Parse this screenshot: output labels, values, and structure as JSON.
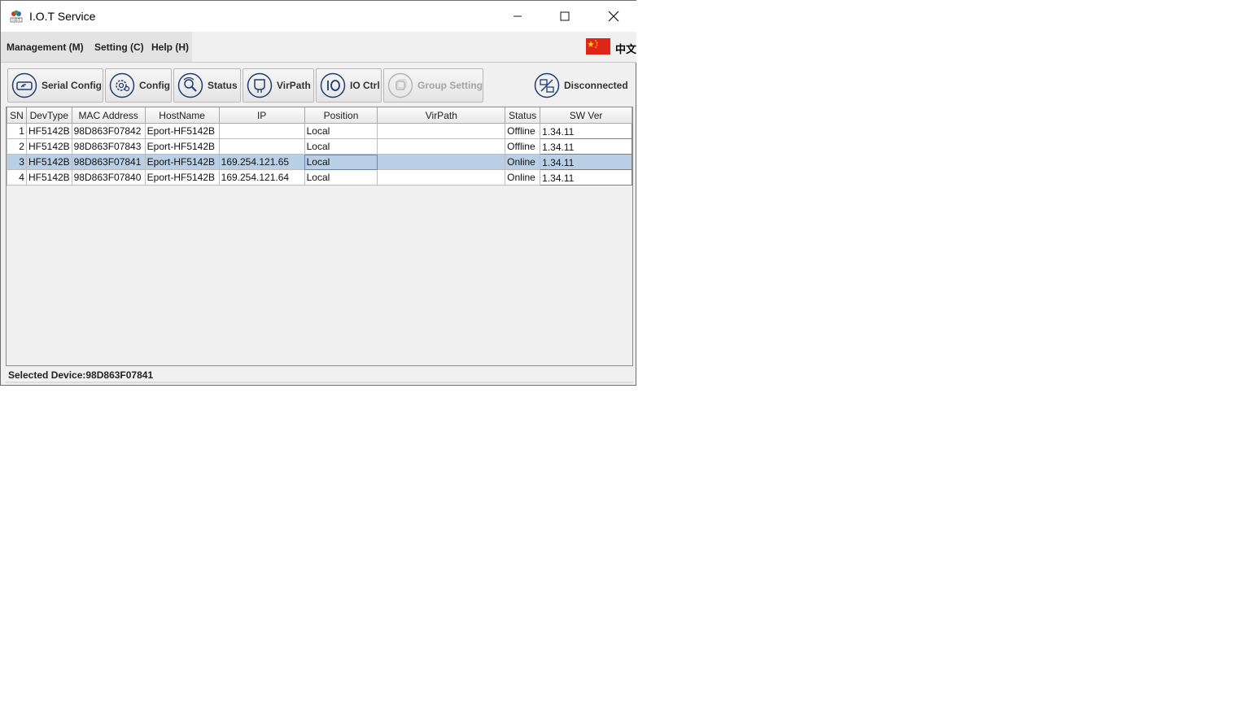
{
  "window": {
    "title": "I.O.T Service",
    "app_icon_caption": "I.O.T"
  },
  "menu": {
    "items": [
      {
        "label": "Management (M)"
      },
      {
        "label": "Setting (C)"
      },
      {
        "label": "Help (H)"
      }
    ],
    "language_label": "中文",
    "language_flag_color": "#e02418"
  },
  "toolbar": {
    "buttons": [
      {
        "label": "Serial Config",
        "icon": "serial-config-icon",
        "enabled": true
      },
      {
        "label": "Config",
        "icon": "gear-icon",
        "enabled": true
      },
      {
        "label": "Status",
        "icon": "status-icon",
        "enabled": true
      },
      {
        "label": "VirPath",
        "icon": "virpath-icon",
        "enabled": true
      },
      {
        "label": "IO Ctrl",
        "icon": "io-ctrl-icon",
        "enabled": true
      },
      {
        "label": "Group Setting",
        "icon": "group-setting-icon",
        "enabled": false
      }
    ],
    "connection_status": "Disconnected",
    "accent_color": "#1f3b73"
  },
  "table": {
    "columns": [
      "SN",
      "DevType",
      "MAC Address",
      "HostName",
      "IP",
      "Position",
      "VirPath",
      "Status",
      "SW Ver"
    ],
    "rows": [
      {
        "sn": "1",
        "devtype": "HF5142B",
        "mac": "98D863F07842",
        "hostname": "Eport-HF5142B",
        "ip": "",
        "position": "Local",
        "virpath": "",
        "status": "Offline",
        "swver": "1.34.11"
      },
      {
        "sn": "2",
        "devtype": "HF5142B",
        "mac": "98D863F07843",
        "hostname": "Eport-HF5142B",
        "ip": "",
        "position": "Local",
        "virpath": "",
        "status": "Offline",
        "swver": "1.34.11"
      },
      {
        "sn": "3",
        "devtype": "HF5142B",
        "mac": "98D863F07841",
        "hostname": "Eport-HF5142B",
        "ip": "169.254.121.65",
        "position": "Local",
        "virpath": "",
        "status": "Online",
        "swver": "1.34.11"
      },
      {
        "sn": "4",
        "devtype": "HF5142B",
        "mac": "98D863F07840",
        "hostname": "Eport-HF5142B",
        "ip": "169.254.121.64",
        "position": "Local",
        "virpath": "",
        "status": "Online",
        "swver": "1.34.11"
      }
    ],
    "selected_row_color": "#b8cfe5"
  },
  "statusbar": {
    "text": "Selected Device:98D863F07841"
  }
}
